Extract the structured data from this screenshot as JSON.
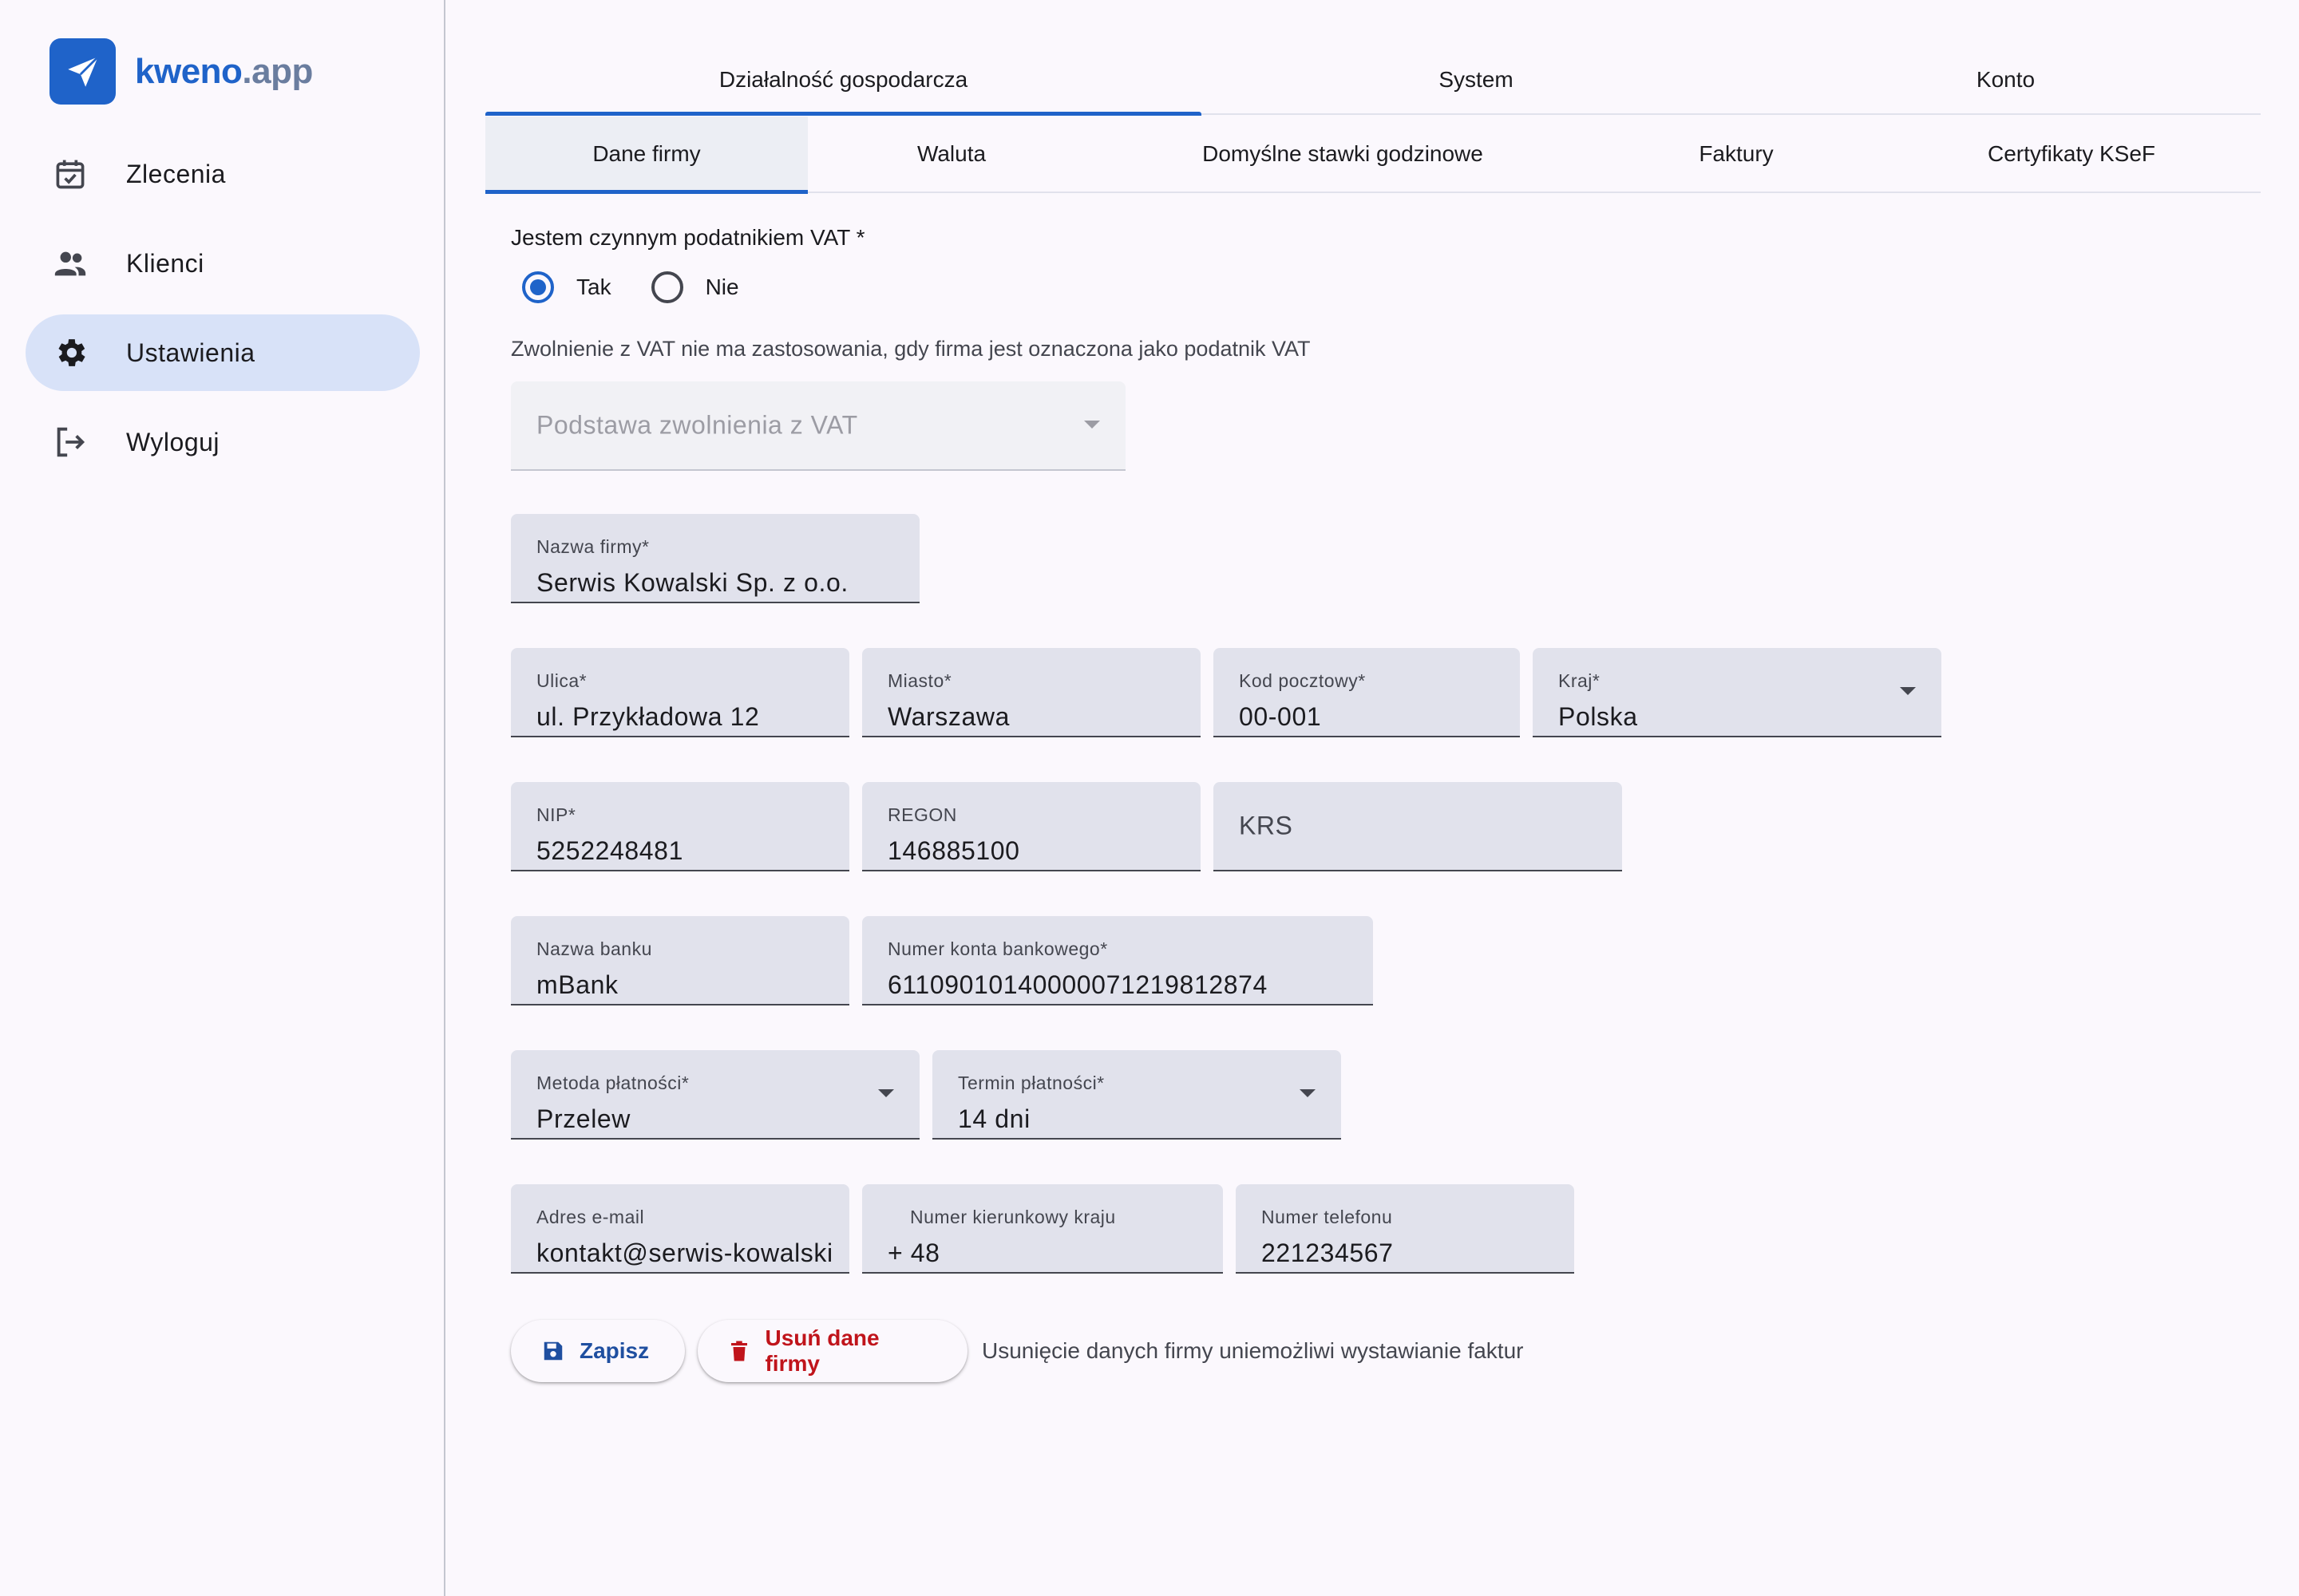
{
  "brand": {
    "name_part1": "kweno",
    "name_part2": ".app",
    "accent": "#1f63c9"
  },
  "sidebar": {
    "items": [
      {
        "label": "Zlecenia",
        "icon": "calendar-check-icon",
        "active": false
      },
      {
        "label": "Klienci",
        "icon": "people-icon",
        "active": false
      },
      {
        "label": "Ustawienia",
        "icon": "gear-icon",
        "active": true
      },
      {
        "label": "Wyloguj",
        "icon": "logout-icon",
        "active": false
      }
    ]
  },
  "tabs_top": [
    {
      "label": "Działalność gospodarcza",
      "active": true
    },
    {
      "label": "System",
      "active": false
    },
    {
      "label": "Konto",
      "active": false
    }
  ],
  "tabs_sub": [
    {
      "label": "Dane firmy",
      "active": true
    },
    {
      "label": "Waluta",
      "active": false
    },
    {
      "label": "Domyślne stawki godzinowe",
      "active": false
    },
    {
      "label": "Faktury",
      "active": false
    },
    {
      "label": "Certyfikaty KSeF",
      "active": false
    }
  ],
  "form": {
    "vat_question": "Jestem czynnym podatnikiem VAT *",
    "vat_options": [
      {
        "label": "Tak",
        "checked": true
      },
      {
        "label": "Nie",
        "checked": false
      }
    ],
    "vat_hint": "Zwolnienie z VAT nie ma zastosowania, gdy firma jest oznaczona jako podatnik VAT",
    "vat_exemption": {
      "placeholder": "Podstawa zwolnienia z VAT"
    },
    "company_name": {
      "label": "Nazwa firmy*",
      "value": "Serwis Kowalski Sp. z o.o."
    },
    "street": {
      "label": "Ulica*",
      "value": "ul. Przykładowa 12"
    },
    "city": {
      "label": "Miasto*",
      "value": "Warszawa"
    },
    "postal_code": {
      "label": "Kod pocztowy*",
      "value": "00-001"
    },
    "country": {
      "label": "Kraj*",
      "value": "Polska"
    },
    "nip": {
      "label": "NIP*",
      "value": "5252248481"
    },
    "regon": {
      "label": "REGON",
      "value": "146885100"
    },
    "krs": {
      "placeholder": "KRS"
    },
    "bank_name": {
      "label": "Nazwa banku",
      "value": "mBank"
    },
    "bank_account": {
      "label": "Numer konta bankowego*",
      "value": "61109010140000071219812874"
    },
    "payment_method": {
      "label": "Metoda płatności*",
      "value": "Przelew"
    },
    "payment_term": {
      "label": "Termin płatności*",
      "value": "14 dni"
    },
    "email": {
      "label": "Adres e-mail",
      "value": "kontakt@serwis-kowalski.pl"
    },
    "country_code": {
      "label": "Numer kierunkowy kraju",
      "value": "+ 48"
    },
    "phone": {
      "label": "Numer telefonu",
      "value": "221234567"
    }
  },
  "actions": {
    "save_label": "Zapisz",
    "delete_label": "Usuń dane firmy",
    "delete_hint": "Usunięcie danych firmy uniemożliwi wystawianie faktur"
  }
}
